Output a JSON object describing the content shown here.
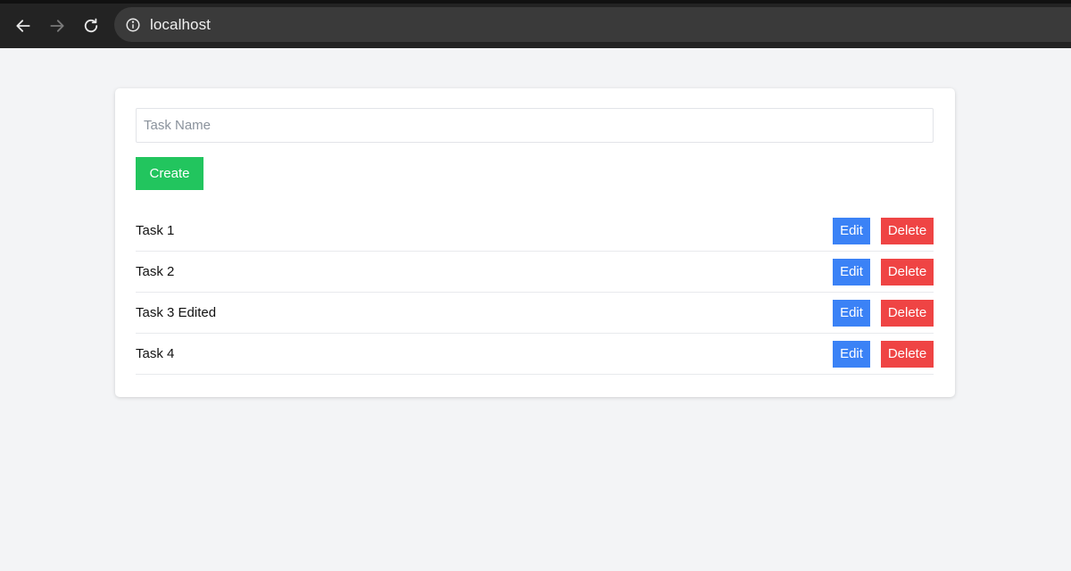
{
  "browser": {
    "url": "localhost",
    "icons": {
      "back": "arrow-left-icon",
      "forward": "arrow-right-icon",
      "reload": "reload-icon",
      "info": "info-icon"
    },
    "forward_disabled": true
  },
  "form": {
    "task_input_placeholder": "Task Name",
    "task_input_value": "",
    "create_label": "Create"
  },
  "tasks": [
    {
      "name": "Task 1",
      "edit_label": "Edit",
      "delete_label": "Delete"
    },
    {
      "name": "Task 2",
      "edit_label": "Edit",
      "delete_label": "Delete"
    },
    {
      "name": "Task 3 Edited",
      "edit_label": "Edit",
      "delete_label": "Delete"
    },
    {
      "name": "Task 4",
      "edit_label": "Edit",
      "delete_label": "Delete"
    }
  ],
  "colors": {
    "page_background": "#f3f4f6",
    "create_button": "#22c55e",
    "edit_button": "#3b82f6",
    "delete_button": "#ef4444",
    "browser_bar": "#232323"
  }
}
